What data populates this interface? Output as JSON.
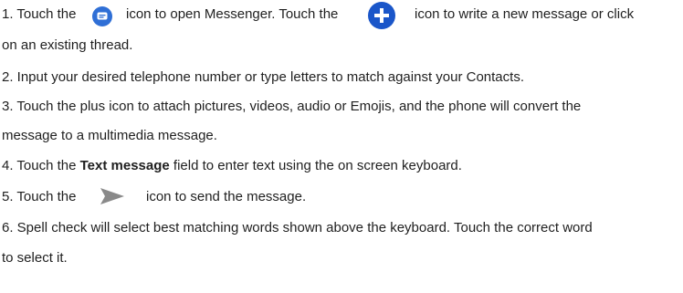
{
  "steps": [
    {
      "p1": "1. Touch the",
      "p2": "icon to open Messenger. Touch the",
      "p3": "icon to write a new message or click",
      "line2": "on an existing thread."
    },
    {
      "text": "2. Input your desired telephone number or type letters to match against your Contacts."
    },
    {
      "line1": "3. Touch the plus icon to attach pictures, videos, audio or Emojis, and the phone will convert the",
      "line2": "message to a multimedia message."
    },
    {
      "pre": "4. Touch the",
      "bold": "Text message",
      "post": "field to enter text using the on screen keyboard."
    },
    {
      "pre": "5. Touch the",
      "post": "icon to send the message."
    },
    {
      "line1": "6. Spell check will select best matching words shown above the keyboard. Touch the correct word",
      "line2": "to select it."
    }
  ],
  "icons": {
    "messenger": "messenger-icon",
    "new_message": "plus-icon",
    "send": "send-icon"
  },
  "colors": {
    "messenger_blue": "#2f6fd6",
    "plus_blue": "#1a56c9",
    "send_gray": "#8a8a8a"
  }
}
